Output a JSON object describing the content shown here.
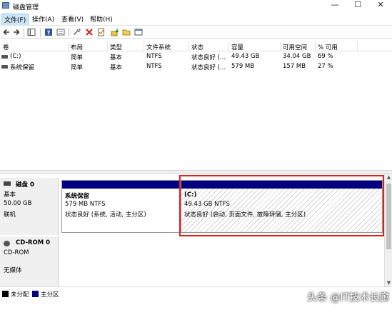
{
  "window": {
    "title": "磁盘管理",
    "minimize_symbol": "—",
    "maximize_symbol": "☐",
    "close_symbol": "✕"
  },
  "menu": [
    {
      "label": "文件(F)"
    },
    {
      "label": "操作(A)"
    },
    {
      "label": "查看(V)"
    },
    {
      "label": "帮助(H)"
    }
  ],
  "toolbar": {
    "icons": [
      "back-arrow-icon",
      "forward-arrow-icon",
      "console-tree-icon",
      "help-icon",
      "properties-icon",
      "connect-icon",
      "delete-icon",
      "checklist-icon",
      "import-icon",
      "open-folder-icon",
      "window-icon"
    ]
  },
  "volume_list": {
    "columns": [
      "卷",
      "布局",
      "类型",
      "文件系统",
      "状态",
      "容量",
      "可用空间",
      "% 可用"
    ],
    "rows": [
      [
        "(C:)",
        "简单",
        "基本",
        "NTFS",
        "状态良好 (...",
        "49.43 GB",
        "34.04 GB",
        "69 %"
      ],
      [
        "系统保留",
        "简单",
        "基本",
        "NTFS",
        "状态良好 (...",
        "579 MB",
        "157 MB",
        "27 %"
      ]
    ]
  },
  "disks": [
    {
      "name": "磁盘 0",
      "type": "基本",
      "size": "50.00 GB",
      "status": "联机",
      "partitions": [
        {
          "title": "系统保留",
          "size": "579 MB NTFS",
          "status": "状态良好 (系统, 活动, 主分区)"
        },
        {
          "title": "(C:)",
          "size": "49.43 GB NTFS",
          "status": "状态良好 (启动, 页面文件, 故障转储, 主分区)"
        }
      ]
    },
    {
      "name": "CD-ROM 0",
      "type": "CD-ROM",
      "media": "无媒体"
    }
  ],
  "legend": [
    {
      "label": "未分配",
      "color": "#000000"
    },
    {
      "label": "主分区",
      "color": "#000080"
    }
  ],
  "watermark": "头条 @IT技术长廊",
  "colors": {
    "partition_bar": "#000080",
    "highlight_border": "#e02020"
  }
}
